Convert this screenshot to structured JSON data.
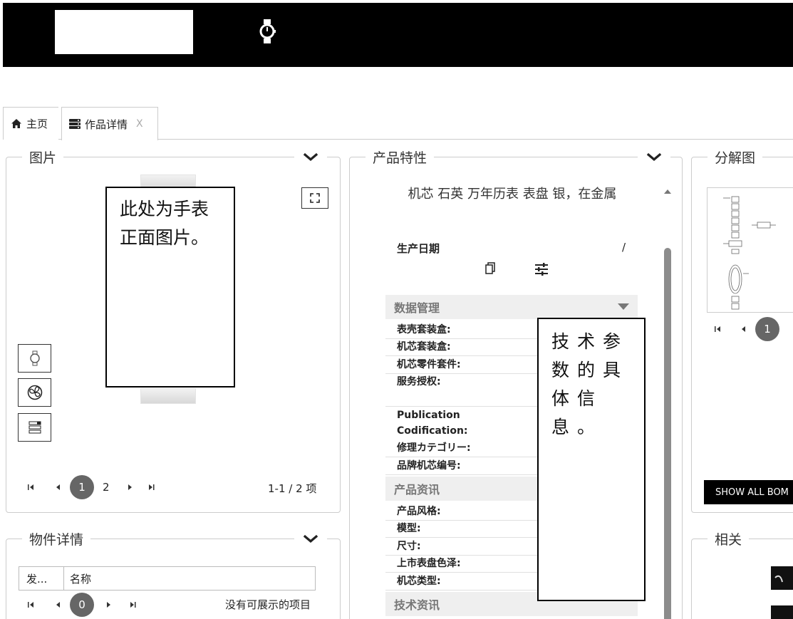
{
  "tabs": {
    "home_label": "主页",
    "detail_label": "作品详情",
    "close_glyph": "X"
  },
  "image_panel": {
    "title": "图片",
    "annotation": "此处为手表正面图片。",
    "pager": {
      "first": "first-icon",
      "prev": "prev-icon",
      "current": "1",
      "next_page": "2",
      "summary": "1-1 / 2 项"
    }
  },
  "parts_panel": {
    "title": "物件详情",
    "columns": [
      "发...",
      "名称"
    ],
    "pager_current": "0",
    "empty_text": "没有可展示的项目"
  },
  "features_panel": {
    "title": "产品特性",
    "product_name": "机芯 石英 万年历表 表盘 银，在金属",
    "production_date_label": "生产日期",
    "production_date_value": "/",
    "annotation": "技术参数的具体信息。",
    "sections": [
      {
        "title": "数据管理",
        "rows": [
          "表壳套装盒:",
          "机芯套装盒:",
          "机芯零件套件:",
          "服务授权:",
          "Publication Codification:",
          "修理カテゴリー:",
          "品牌机芯编号:"
        ]
      },
      {
        "title": "产品资讯",
        "rows": [
          "产品风格:",
          "模型:",
          "尺寸:",
          "上市表盘色泽:",
          "机芯类型:"
        ]
      },
      {
        "title": "技术资讯",
        "rows": []
      }
    ]
  },
  "exploded_panel": {
    "title": "分解图",
    "pager_current": "1",
    "show_all_label": "SHOW ALL BOM"
  },
  "related_panel": {
    "title": "相关"
  },
  "colors": {
    "topbar": "#000000",
    "pager_active": "#666666",
    "section_bg": "#efefef"
  }
}
